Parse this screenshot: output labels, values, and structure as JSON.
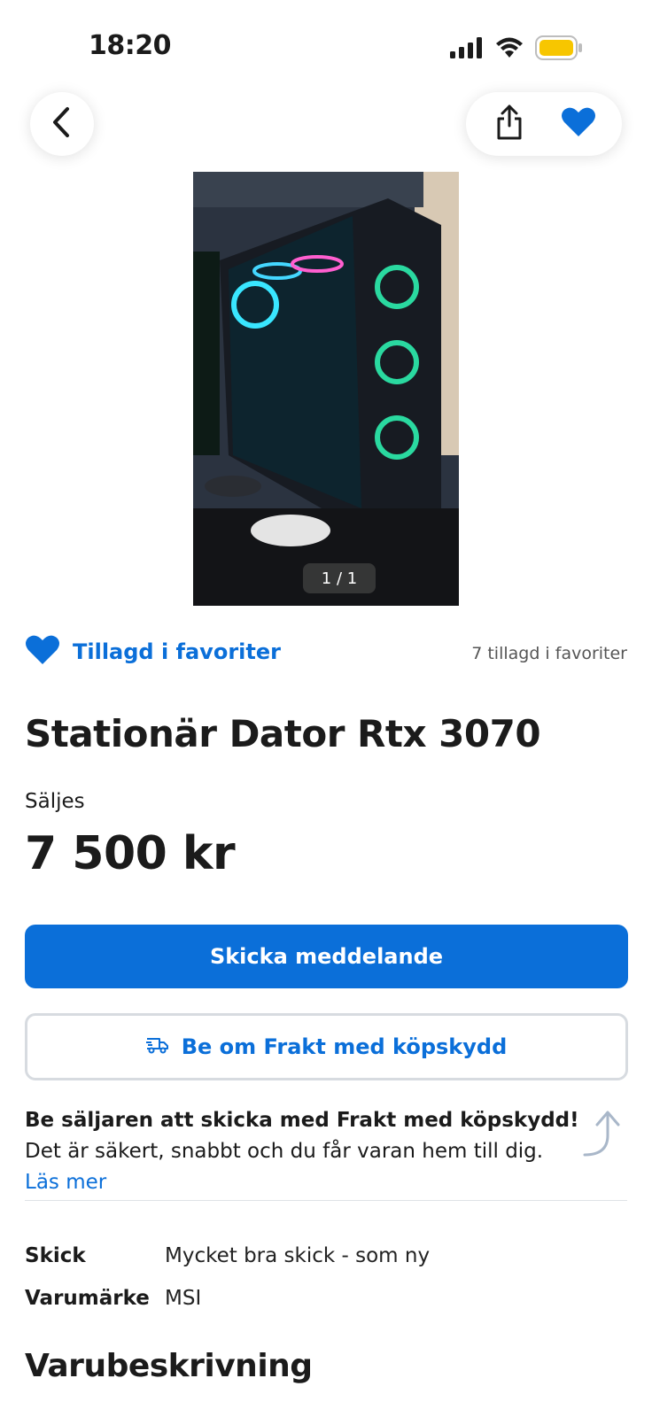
{
  "status_bar": {
    "time": "18:20",
    "battery_color": "#f7c600"
  },
  "nav": {
    "back_icon": "chevron-left-icon",
    "share_icon": "share-icon",
    "favorite_icon": "heart-filled-icon"
  },
  "listing": {
    "image_counter": "1 / 1",
    "favorite_label": "Tillagd i favoriter",
    "favorite_count": "7 tillagd i favoriter",
    "title": "Stationär Dator Rtx 3070",
    "sale_type": "Säljes",
    "price": "7 500 kr"
  },
  "actions": {
    "message_button": "Skicka meddelande",
    "shipping_button": "Be om Frakt med köpskydd"
  },
  "shipping_info": {
    "bold": "Be säljaren att skicka med Frakt med köpskydd!",
    "text": " Det är säkert, snabbt och du får varan hem till dig. ",
    "link": "Läs mer"
  },
  "properties": [
    {
      "key": "Skick",
      "value": "Mycket bra skick - som ny"
    },
    {
      "key": "Varumärke",
      "value": "MSI"
    }
  ],
  "description": {
    "heading": "Varubeskrivning"
  },
  "colors": {
    "accent": "#0b6fd9",
    "text": "#1b1b1b"
  }
}
